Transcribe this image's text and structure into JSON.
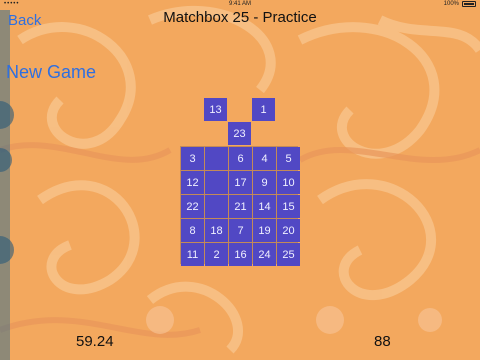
{
  "status_bar": {
    "carrier": "•••••",
    "time": "9:41 AM",
    "battery_text": "100%"
  },
  "nav": {
    "back_label": "Back",
    "title": "Matchbox 25 - Practice"
  },
  "new_game_label": "New Game",
  "loose_tiles": [
    "13",
    "1",
    "23"
  ],
  "grid": [
    [
      "3",
      "",
      "6",
      "4",
      "5"
    ],
    [
      "12",
      "",
      "17",
      "9",
      "10"
    ],
    [
      "22",
      "",
      "21",
      "14",
      "15"
    ],
    [
      "8",
      "18",
      "7",
      "19",
      "20"
    ],
    [
      "11",
      "2",
      "16",
      "24",
      "25"
    ]
  ],
  "timer": "59.24",
  "score": "88",
  "colors": {
    "tile": "#5148c4",
    "background": "#f3a85e",
    "link": "#2f6fe0"
  }
}
